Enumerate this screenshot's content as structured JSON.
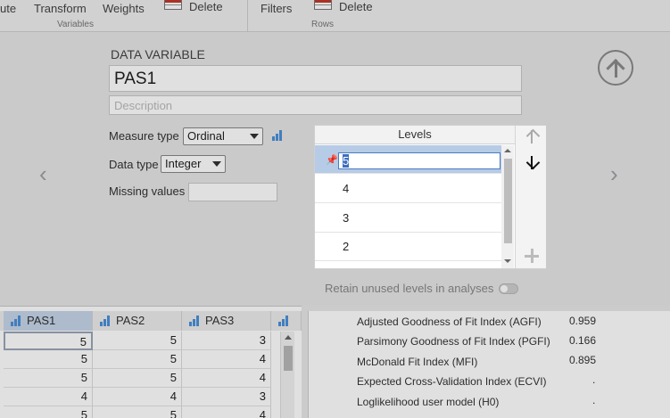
{
  "ribbon": {
    "compute_partial": "ute",
    "transform": "Transform",
    "weights": "Weights",
    "delete_variables": "Delete",
    "variables_group": "Variables",
    "filters": "Filters",
    "delete_rows": "Delete",
    "rows_group": "Rows"
  },
  "editor": {
    "header": "DATA VARIABLE",
    "variable_name": "PAS1",
    "description_placeholder": "Description",
    "measure_type_label": "Measure type",
    "measure_type_value": "Ordinal",
    "data_type_label": "Data type",
    "data_type_value": "Integer",
    "missing_values_label": "Missing values",
    "retain_label": "Retain unused levels in analyses"
  },
  "levels": {
    "title": "Levels",
    "editing_value": "5",
    "items": [
      "4",
      "3",
      "2"
    ]
  },
  "sheet": {
    "columns": [
      "PAS1",
      "PAS2",
      "PAS3"
    ],
    "rows": [
      [
        "5",
        "5",
        "3"
      ],
      [
        "5",
        "5",
        "4"
      ],
      [
        "5",
        "5",
        "4"
      ],
      [
        "4",
        "4",
        "3"
      ],
      [
        "5",
        "5",
        "4"
      ]
    ]
  },
  "results": [
    {
      "label": "Adjusted Goodness of Fit Index (AGFI)",
      "value": "0.959"
    },
    {
      "label": "Parsimony Goodness of Fit Index (PGFI)",
      "value": "0.166"
    },
    {
      "label": "McDonald Fit Index (MFI)",
      "value": "0.895"
    },
    {
      "label": "Expected Cross-Validation Index (ECVI)",
      "value": "."
    },
    {
      "label": "Loglikelihood user model (H0)",
      "value": "."
    }
  ]
}
